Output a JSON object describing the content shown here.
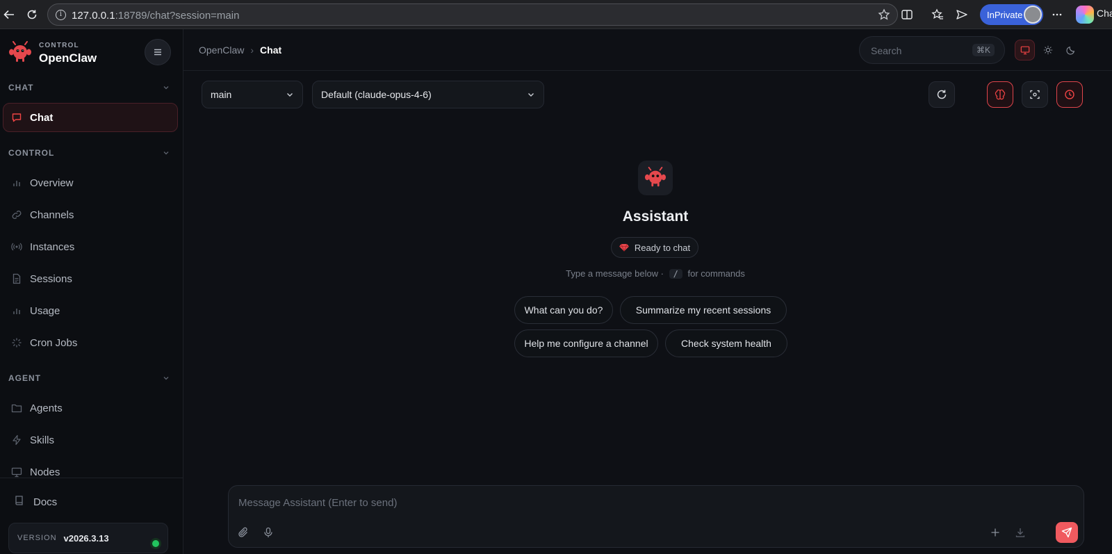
{
  "browser": {
    "url_host": "127.0.0.1",
    "url_rest": ":18789/chat?session=main",
    "inprivate_label": "InPrivate",
    "tail_text": "Cha"
  },
  "sidebar": {
    "brand_small": "CONTROL",
    "brand_name": "OpenClaw",
    "sections": {
      "chat": "CHAT",
      "control": "CONTROL",
      "agent": "AGENT"
    },
    "items": [
      {
        "label": "Chat",
        "icon": "message-square-icon"
      },
      {
        "label": "Overview",
        "icon": "bar-chart-icon"
      },
      {
        "label": "Channels",
        "icon": "link-icon"
      },
      {
        "label": "Instances",
        "icon": "radio-icon"
      },
      {
        "label": "Sessions",
        "icon": "file-text-icon"
      },
      {
        "label": "Usage",
        "icon": "bar-chart-icon"
      },
      {
        "label": "Cron Jobs",
        "icon": "loader-icon"
      },
      {
        "label": "Agents",
        "icon": "folder-icon"
      },
      {
        "label": "Skills",
        "icon": "zap-icon"
      },
      {
        "label": "Nodes",
        "icon": "monitor-icon"
      }
    ],
    "docs_label": "Docs",
    "version_label": "VERSION",
    "version_value": "v2026.3.13"
  },
  "header": {
    "breadcrumb_root": "OpenClaw",
    "breadcrumb_sep": "›",
    "breadcrumb_current": "Chat",
    "search_placeholder": "Search",
    "search_shortcut": "⌘K"
  },
  "toolbar": {
    "session_value": "main",
    "model_value": "Default (claude-opus-4-6)"
  },
  "empty_state": {
    "title": "Assistant",
    "status": "Ready to chat",
    "hint_before": "Type a message below ·",
    "hint_key": "/",
    "hint_after": "for commands",
    "suggestions": [
      "What can you do?",
      "Summarize my recent sessions",
      "Help me configure a channel",
      "Check system health"
    ]
  },
  "composer": {
    "placeholder": "Message Assistant (Enter to send)"
  },
  "colors": {
    "accent": "#ef4444",
    "background": "#0e1015",
    "sidebar_bg": "#0c0e12",
    "status_ok": "#22c55e"
  }
}
